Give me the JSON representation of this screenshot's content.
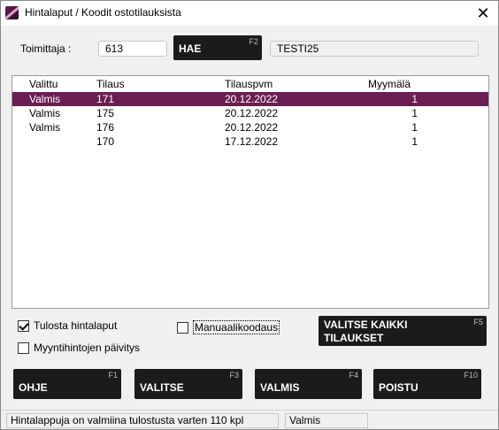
{
  "window": {
    "title": "Hintalaput / Koodit ostotilauksista",
    "close_glyph": "✕"
  },
  "supplier": {
    "label": "Toimittaja :",
    "code": "613",
    "name": "TESTI25"
  },
  "search_button": {
    "label": "HAE",
    "fkey": "F2"
  },
  "list": {
    "columns": [
      "Valittu",
      "Tilaus",
      "Tilauspvm",
      "Myymälä"
    ],
    "rows": [
      {
        "valittu": "Valmis",
        "tilaus": "171",
        "pvm": "20.12.2022",
        "myymala": "1",
        "selected": true
      },
      {
        "valittu": "Valmis",
        "tilaus": "175",
        "pvm": "20.12.2022",
        "myymala": "1",
        "selected": false
      },
      {
        "valittu": "Valmis",
        "tilaus": "176",
        "pvm": "20.12.2022",
        "myymala": "1",
        "selected": false
      },
      {
        "valittu": "",
        "tilaus": "170",
        "pvm": "17.12.2022",
        "myymala": "1",
        "selected": false
      }
    ]
  },
  "options": {
    "print_labels": {
      "label": "Tulosta hintalaput",
      "checked": true
    },
    "update_prices": {
      "label": "Myyntihintojen päivitys",
      "checked": false
    },
    "manual_coding": {
      "label": "Manuaalikoodaus",
      "checked": false
    }
  },
  "select_all_button": {
    "line1": "VALITSE KAIKKI",
    "line2": "TILAUKSET",
    "fkey": "F5"
  },
  "bottom_buttons": [
    {
      "label": "OHJE",
      "fkey": "F1"
    },
    {
      "label": "VALITSE",
      "fkey": "F3"
    },
    {
      "label": "VALMIS",
      "fkey": "F4"
    },
    {
      "label": "POISTU",
      "fkey": "F10"
    }
  ],
  "status": {
    "message": "Hintalappuja on valmiina tulostusta varten 110  kpl",
    "state": "Valmis"
  },
  "colors": {
    "selection": "#6b1e52",
    "button_bg": "#1b1b1b"
  }
}
